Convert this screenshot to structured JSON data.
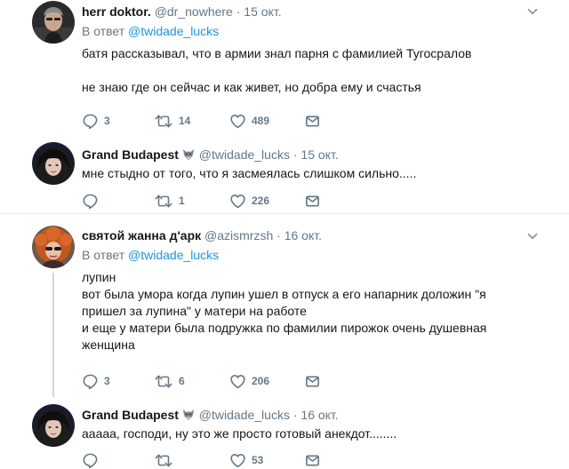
{
  "tweets": [
    {
      "name": "herr doktor.",
      "handle": "@dr_nowhere",
      "dot": "·",
      "date": "15 окт.",
      "reply_prefix": "В ответ",
      "reply_to": "@twidade_lucks",
      "lines": [
        "батя рассказывал, что в армии знал парня с фамилией Тугосралов",
        "",
        "не знаю где он сейчас и как живет, но добра ему и счастья"
      ],
      "replies": "3",
      "retweets": "14",
      "likes": "489"
    },
    {
      "name": "Grand Budapest",
      "handle": "@twidade_lucks",
      "dot": "·",
      "date": "15 окт.",
      "lines": [
        "мне стыдно от того, что я засмеялась слишком сильно....."
      ],
      "replies": "",
      "retweets": "1",
      "likes": "226"
    },
    {
      "name": "святой жанна д'арк",
      "handle": "@azismrzsh",
      "dot": "·",
      "date": "16 окт.",
      "reply_prefix": "В ответ",
      "reply_to": "@twidade_lucks",
      "lines": [
        "лупин",
        "вот была умора когда лупин ушел в отпуск а его напарник доложин \"я",
        "пришел за лупина\" у матери на работе",
        "и еще у матери была подружка по фамилии пирожок очень душевная",
        "женщина"
      ],
      "replies": "3",
      "retweets": "6",
      "likes": "206"
    },
    {
      "name": "Grand Budapest",
      "handle": "@twidade_lucks",
      "dot": "·",
      "date": "16 окт.",
      "lines": [
        "ааааа, господи, ну это же просто готовый анекдот........"
      ],
      "replies": "",
      "retweets": "",
      "likes": "53"
    }
  ],
  "colors": {
    "link": "#1b95e0",
    "secondary": "#657786",
    "separator": "#e6ecf0",
    "thread_line": "#ccd6dd"
  },
  "icons": [
    "reply-icon",
    "retweet-icon",
    "heart-icon",
    "envelope-icon",
    "chevron-down-icon",
    "wolf-emoji-icon"
  ]
}
